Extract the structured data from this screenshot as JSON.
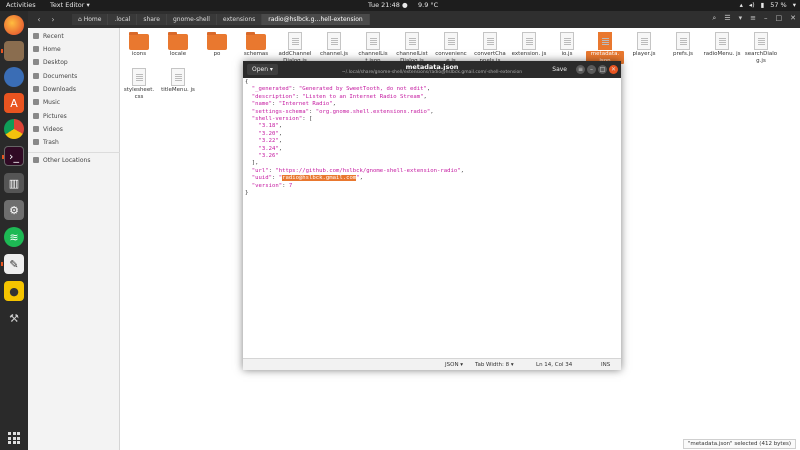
{
  "topbar": {
    "activities": "Activities",
    "app_menu": "Text Editor ▾",
    "clock": "Tue 21:48 ●",
    "weather": "9.9 °C",
    "battery": "57 %"
  },
  "files": {
    "breadcrumbs": [
      {
        "label": "Home"
      },
      {
        "label": ".local"
      },
      {
        "label": "share"
      },
      {
        "label": "gnome-shell"
      },
      {
        "label": "extensions"
      },
      {
        "label": "radio@hslbck.g…hell-extension"
      }
    ],
    "sidebar": [
      {
        "label": "Recent"
      },
      {
        "label": "Home"
      },
      {
        "label": "Desktop"
      },
      {
        "label": "Documents"
      },
      {
        "label": "Downloads"
      },
      {
        "label": "Music"
      },
      {
        "label": "Pictures"
      },
      {
        "label": "Videos"
      },
      {
        "label": "Trash"
      },
      {
        "label": "Other Locations"
      }
    ],
    "items_row1": [
      {
        "label": "icons",
        "kind": "folder"
      },
      {
        "label": "locale",
        "kind": "folder"
      },
      {
        "label": "po",
        "kind": "folder"
      },
      {
        "label": "schemas",
        "kind": "folder"
      },
      {
        "label": "addChannel Dialog.js",
        "kind": "doc"
      },
      {
        "label": "channel.js",
        "kind": "doc"
      },
      {
        "label": "channelLis t.json",
        "kind": "doc"
      },
      {
        "label": "channelList Dialog.js",
        "kind": "doc"
      },
      {
        "label": "convenienc e.js",
        "kind": "doc"
      },
      {
        "label": "convertCha nnels.js",
        "kind": "doc"
      },
      {
        "label": "extension. js",
        "kind": "doc"
      },
      {
        "label": "io.js",
        "kind": "doc"
      },
      {
        "label": "metadata. json",
        "kind": "doc",
        "selected": true
      },
      {
        "label": "player.js",
        "kind": "doc"
      },
      {
        "label": "prefs.js",
        "kind": "doc"
      },
      {
        "label": "radioMenu. js",
        "kind": "doc"
      },
      {
        "label": "searchDialo g.js",
        "kind": "doc"
      }
    ],
    "items_row2": [
      {
        "label": "stylesheet. css",
        "kind": "doc"
      },
      {
        "label": "titleMenu. js",
        "kind": "doc"
      }
    ],
    "status_tip": "\"metadata.json\" selected (412 bytes)"
  },
  "editor": {
    "open_label": "Open ▾",
    "title": "metadata.json",
    "path": "~/.local/share/gnome-shell/extensions/radio@hslbck.gmail.com/-shell-extension",
    "save_label": "Save",
    "lines": {
      "l1": "{",
      "generated_key": "\"_generated\"",
      "generated_val": "\"Generated by SweetTooth, do not edit\"",
      "description_key": "\"description\"",
      "description_val": "\"Listen to an Internet Radio Stream\"",
      "name_key": "\"name\"",
      "name_val": "\"Internet Radio\"",
      "schema_key": "\"settings-schema\"",
      "schema_val": "\"org.gnome.shell.extensions.radio\"",
      "shell_key": "\"shell-version\"",
      "versions": [
        "\"3.18\"",
        "\"3.20\"",
        "\"3.22\"",
        "\"3.24\"",
        "\"3.26\""
      ],
      "url_key": "\"url\"",
      "url_val": "\"https://github.com/hslbck/gnome-shell-extension-radio\"",
      "uuid_key": "\"uuid\"",
      "uuid_val": "radio@hslbck.gmail.com",
      "version_key": "\"version\"",
      "version_val": "7",
      "close": "}"
    },
    "footer": {
      "language": "JSON ▾",
      "tab_width": "Tab Width: 8 ▾",
      "position": "Ln 14, Col 34",
      "mode": "INS"
    }
  },
  "colors": {
    "accent": "#e9782f",
    "syntax": "#c4179f",
    "topbar": "#1d1d1d"
  }
}
